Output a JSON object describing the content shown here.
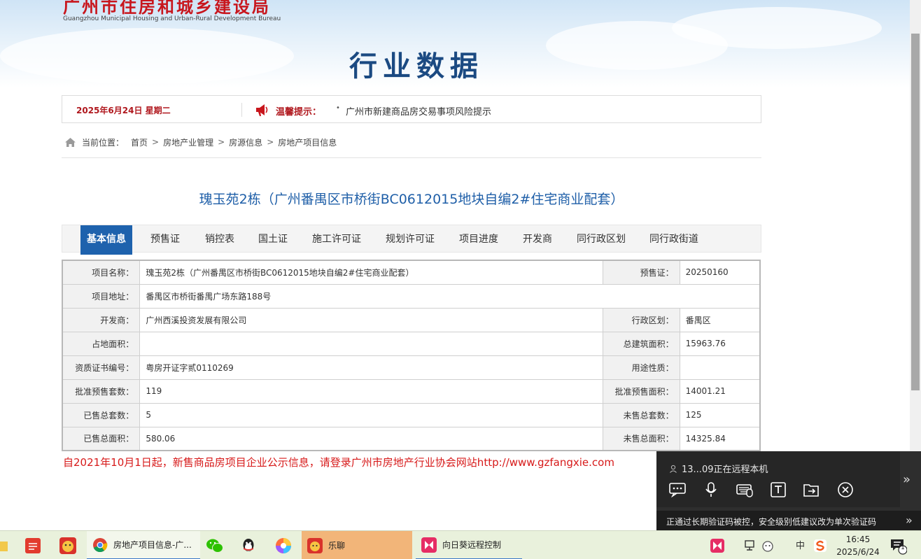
{
  "header": {
    "logo_cn": "广州市住房和城乡建设局",
    "logo_en": "Guangzhou Municipal Housing and Urban-Rural Development Bureau",
    "heading": "行业数据"
  },
  "notice": {
    "date": "2025年6月24日 星期二",
    "warn_label": "温馨提示：",
    "bullet": "•",
    "message": "广州市新建商品房交易事项风险提示"
  },
  "breadcrumb": {
    "prefix": "当前位置：",
    "items": [
      "首页",
      "房地产业管理",
      "房源信息",
      "房地产项目信息"
    ],
    "separator": ">"
  },
  "project_title": "瑰玉苑2栋（广州番禺区市桥街BC0612015地块自编2#住宅商业配套）",
  "tabs": [
    {
      "label": "基本信息",
      "active": true
    },
    {
      "label": "预售证"
    },
    {
      "label": "销控表"
    },
    {
      "label": "国土证"
    },
    {
      "label": "施工许可证"
    },
    {
      "label": "规划许可证"
    },
    {
      "label": "项目进度"
    },
    {
      "label": "开发商"
    },
    {
      "label": "同行政区划"
    },
    {
      "label": "同行政街道"
    }
  ],
  "info": {
    "project_name_label": "项目名称：",
    "project_name": "瑰玉苑2栋（广州番禺区市桥街BC0612015地块自编2#住宅商业配套）",
    "presale_label": "预售证：",
    "presale": "20250160",
    "address_label": "项目地址：",
    "address": "番禺区市桥街番禺广场东路188号",
    "developer_label": "开发商：",
    "developer": "广州西溪投资发展有限公司",
    "district_label": "行政区划：",
    "district": "番禺区",
    "land_area_label": "占地面积：",
    "land_area": "",
    "total_build_area_label": "总建筑面积：",
    "total_build_area": "15963.76",
    "cert_no_label": "资质证书编号：",
    "cert_no": "粤房开证字贰0110269",
    "usage_label": "用途性质：",
    "usage": "",
    "approved_units_label": "批准预售套数：",
    "approved_units": "119",
    "approved_area_label": "批准预售面积：",
    "approved_area": "14001.21",
    "sold_units_label": "已售总套数：",
    "sold_units": "5",
    "unsold_units_label": "未售总套数：",
    "unsold_units": "125",
    "sold_area_label": "已售总面积：",
    "sold_area": "580.06",
    "unsold_area_label": "未售总面积：",
    "unsold_area": "14325.84"
  },
  "footnote": "自2021年10月1日起，新售商品房项目企业公示信息，请登录广州市房地产行业协会网站http://www.gzfangxie.com",
  "remote": {
    "user": "13...09正在远程本机",
    "side_arrow": "»",
    "security_msg": "正通过长期验证码被控，安全级别低建议改为单次验证码",
    "bottom_arrow": "»"
  },
  "taskbar": {
    "browser_task": "房地产项目信息-广...",
    "chat_task": "乐聊",
    "remote_task": "向日葵远程控制",
    "ime_label": "中",
    "time": "16:45",
    "date": "2025/6/24",
    "notification_count": "1"
  },
  "colors": {
    "accent_blue": "#1e62ad",
    "title_blue": "#1f5fa8",
    "warning_red": "#b0181e",
    "footnote_red": "#d71a1a"
  }
}
